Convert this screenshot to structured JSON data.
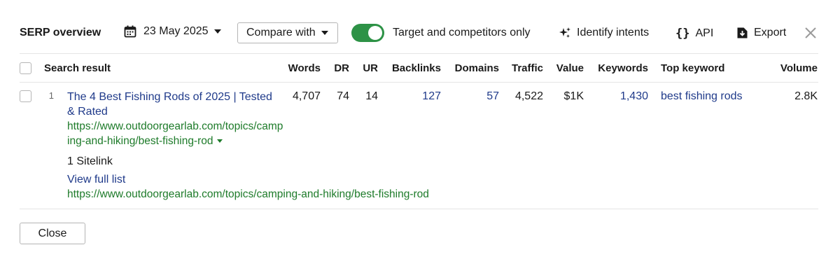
{
  "header": {
    "title": "SERP overview",
    "date": "23 May 2025",
    "compare_label": "Compare with",
    "toggle_label": "Target and competitors only",
    "toggle_on": true,
    "identify_label": "Identify intents",
    "api_label": "API",
    "export_label": "Export"
  },
  "table": {
    "columns": [
      "Search result",
      "Words",
      "DR",
      "UR",
      "Backlinks",
      "Domains",
      "Traffic",
      "Value",
      "Keywords",
      "Top keyword",
      "Volume"
    ],
    "rows": [
      {
        "position": "1",
        "title": "The 4 Best Fishing Rods of 2025 | Tested & Rated",
        "url": "https://www.outdoorgearlab.com/topics/camping-and-hiking/best-fishing-rod",
        "words": "4,707",
        "dr": "74",
        "ur": "14",
        "backlinks": "127",
        "domains": "57",
        "traffic": "4,522",
        "value": "$1K",
        "keywords": "1,430",
        "top_keyword": "best fishing rods",
        "volume": "2.8K",
        "sitelink_count": "1 Sitelink",
        "view_full_list": "View full list",
        "sitelink_url": "https://www.outdoorgearlab.com/topics/camping-and-hiking/best-fishing-rod"
      }
    ]
  },
  "footer": {
    "close_label": "Close"
  },
  "colors": {
    "accent_green": "#2d9246",
    "link_blue": "#1f3a8a",
    "url_green": "#1e7b2a"
  }
}
